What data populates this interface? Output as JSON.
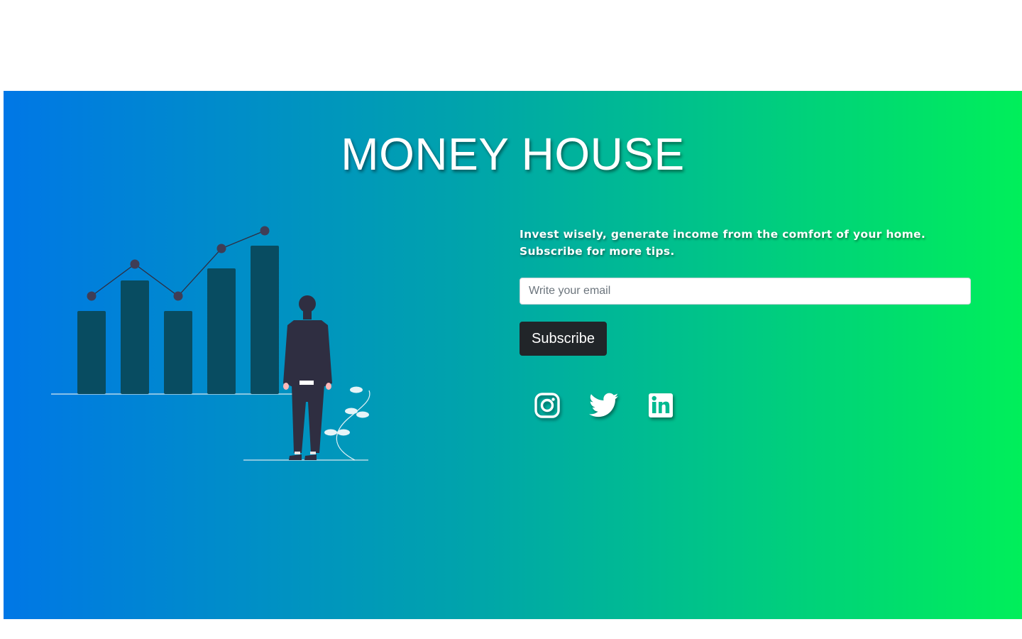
{
  "hero": {
    "title": "MONEY HOUSE",
    "tagline": "Invest wisely, generate income from the comfort of your home. Subscribe for more tips.",
    "gradient": [
      "#0077e6",
      "#00ef5a"
    ]
  },
  "subscribe_form": {
    "email_placeholder": "Write your email",
    "email_value": "",
    "button_label": "Subscribe"
  },
  "social_links": [
    {
      "icon": "instagram-icon"
    },
    {
      "icon": "twitter-icon"
    },
    {
      "icon": "linkedin-icon"
    }
  ],
  "colors": {
    "bar": "#084c61",
    "person": "#2f2e41",
    "button_bg": "#212529",
    "text": "#ffffff"
  }
}
